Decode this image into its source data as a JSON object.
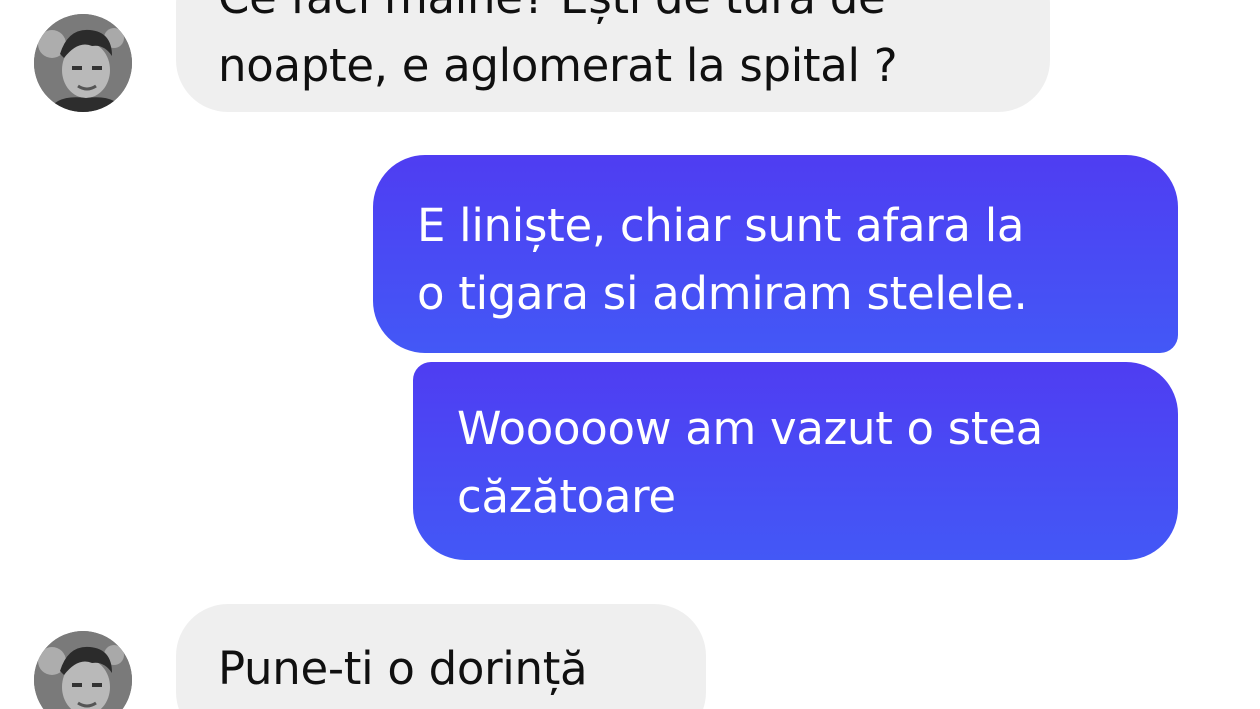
{
  "conversation": {
    "messages": [
      {
        "sender": "contact",
        "lines": [
          "Ce faci mâine? Ești de tură de",
          "noapte, e aglomerat la spital ?"
        ]
      },
      {
        "sender": "me",
        "lines": [
          "E liniște, chiar sunt afara la",
          "o tigara si admiram stelele."
        ]
      },
      {
        "sender": "me",
        "lines": [
          "Wooooow am vazut o stea",
          "căzătoare"
        ]
      },
      {
        "sender": "contact",
        "lines": [
          "Pune-ti o dorință"
        ]
      }
    ]
  },
  "colors": {
    "incoming_bubble": "#efefef",
    "outgoing_bubble_top": "#4f3df2",
    "outgoing_bubble_bottom": "#4358f6",
    "outgoing_text": "#ffffff",
    "incoming_text": "#101010"
  },
  "icons": {
    "contact_avatar": "profile-photo"
  }
}
